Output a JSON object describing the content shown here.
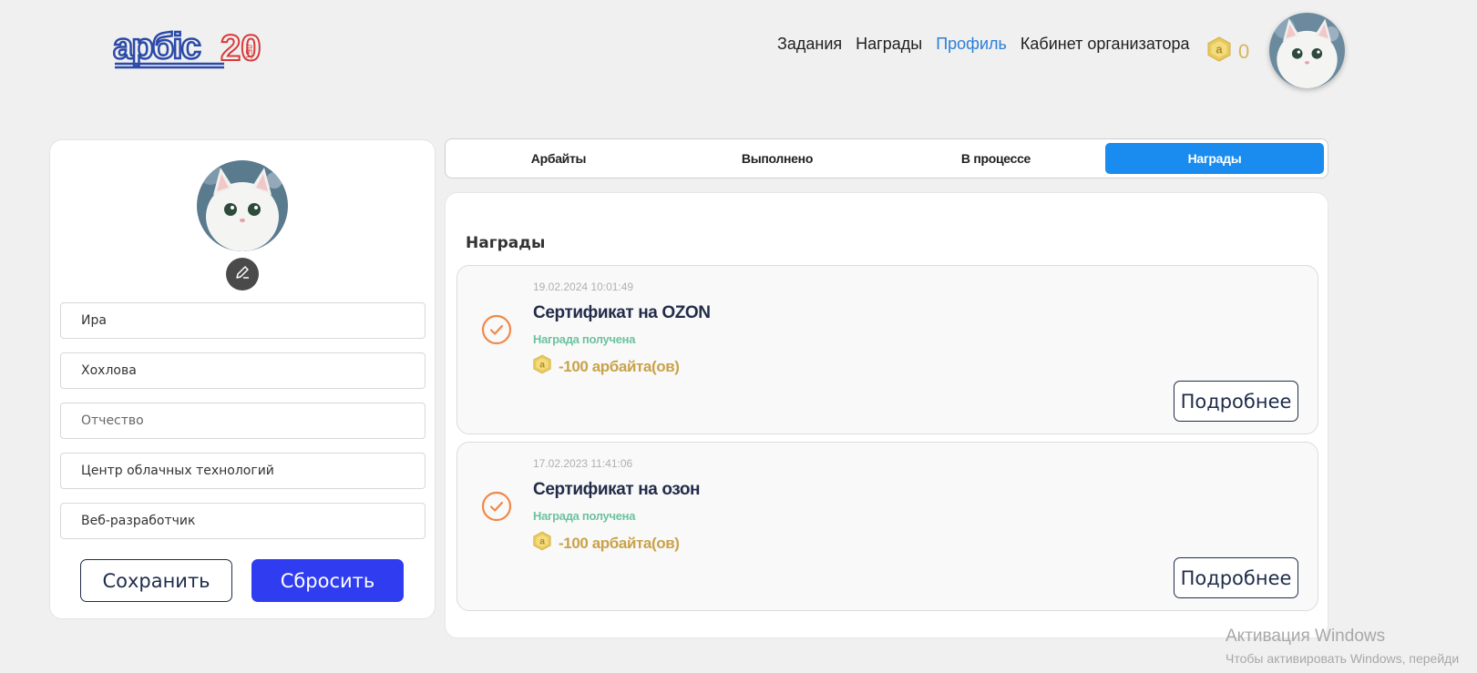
{
  "header": {
    "logo_text": "арбіс",
    "logo_badge": "20 ЛЕТ",
    "nav": [
      {
        "label": "Задания",
        "active": false
      },
      {
        "label": "Награды",
        "active": false
      },
      {
        "label": "Профиль",
        "active": true
      },
      {
        "label": "Кабинет организатора",
        "active": false
      }
    ],
    "coin_balance": "0",
    "coin_icon": "arbait-coin-icon",
    "accent_color": "#2a7fd6"
  },
  "profile": {
    "avatar": "cat-avatar",
    "fields": [
      {
        "name": "first-name-field",
        "value": "Ира",
        "is_placeholder": false
      },
      {
        "name": "last-name-field",
        "value": "Хохлова",
        "is_placeholder": false
      },
      {
        "name": "patronymic-field",
        "value": "Отчество",
        "is_placeholder": true
      },
      {
        "name": "department-field",
        "value": "Центр облачных технологий",
        "is_placeholder": false
      },
      {
        "name": "position-field",
        "value": "Веб-разработчик",
        "is_placeholder": false
      }
    ],
    "save_label": "Сохранить",
    "reset_label": "Сбросить"
  },
  "tabs": [
    {
      "label": "Арбайты",
      "active": false
    },
    {
      "label": "Выполнено",
      "active": false
    },
    {
      "label": "В процессе",
      "active": false
    },
    {
      "label": "Награды",
      "active": true
    }
  ],
  "rewards": {
    "title": "Награды",
    "items": [
      {
        "date": "19.02.2024 10:01:49",
        "title": "Сертификат на OZON",
        "status": "Награда получена",
        "cost": "-100 арбайта(ов)",
        "more_label": "Подробнее"
      },
      {
        "date": "17.02.2023 11:41:06",
        "title": "Сертификат на озон",
        "status": "Награда получена",
        "cost": "-100 арбайта(ов)",
        "more_label": "Подробнее"
      }
    ]
  },
  "watermark": {
    "line1": "Активация Windows",
    "line2": "Чтобы активировать Windows, перейди"
  },
  "colors": {
    "primary_button": "#2f3cf0",
    "active_tab": "#1a8cf0",
    "status_green": "#6cc3a0",
    "coin_gold": "#c9a24a",
    "check_orange": "#f0884a"
  }
}
